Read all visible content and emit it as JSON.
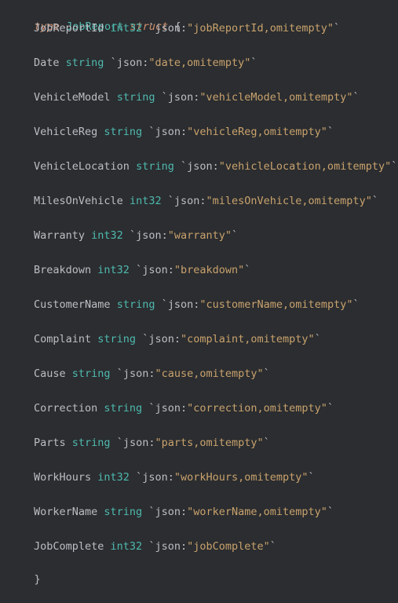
{
  "code": {
    "header": {
      "keyword": "type",
      "name": "JobReport",
      "struct_keyword": "struct",
      "open_brace": "{"
    },
    "fields": [
      {
        "name": "JobReportId",
        "type": "int32",
        "tag_prefix": "`json:",
        "tag_value": "\"jobReportId,omitempty\"",
        "tag_suffix": "`"
      },
      {
        "name": "Date",
        "type": "string",
        "tag_prefix": "`json:",
        "tag_value": "\"date,omitempty\"",
        "tag_suffix": "`"
      },
      {
        "name": "VehicleModel",
        "type": "string",
        "tag_prefix": "`json:",
        "tag_value": "\"vehicleModel,omitempty\"",
        "tag_suffix": "`"
      },
      {
        "name": "VehicleReg",
        "type": "string",
        "tag_prefix": "`json:",
        "tag_value": "\"vehicleReg,omitempty\"",
        "tag_suffix": "`"
      },
      {
        "name": "VehicleLocation",
        "type": "string",
        "tag_prefix": "`json:",
        "tag_value": "\"vehicleLocation,omitempty\"",
        "tag_suffix": "`"
      },
      {
        "name": "MilesOnVehicle",
        "type": "int32",
        "tag_prefix": "`json:",
        "tag_value": "\"milesOnVehicle,omitempty\"",
        "tag_suffix": "`"
      },
      {
        "name": "Warranty",
        "type": "int32",
        "tag_prefix": "`json:",
        "tag_value": "\"warranty\"",
        "tag_suffix": "`"
      },
      {
        "name": "Breakdown",
        "type": "int32",
        "tag_prefix": "`json:",
        "tag_value": "\"breakdown\"",
        "tag_suffix": "`"
      },
      {
        "name": "CustomerName",
        "type": "string",
        "tag_prefix": "`json:",
        "tag_value": "\"customerName,omitempty\"",
        "tag_suffix": "`"
      },
      {
        "name": "Complaint",
        "type": "string",
        "tag_prefix": "`json:",
        "tag_value": "\"complaint,omitempty\"",
        "tag_suffix": "`"
      },
      {
        "name": "Cause",
        "type": "string",
        "tag_prefix": "`json:",
        "tag_value": "\"cause,omitempty\"",
        "tag_suffix": "`"
      },
      {
        "name": "Correction",
        "type": "string",
        "tag_prefix": "`json:",
        "tag_value": "\"correction,omitempty\"",
        "tag_suffix": "`"
      },
      {
        "name": "Parts",
        "type": "string",
        "tag_prefix": "`json:",
        "tag_value": "\"parts,omitempty\"",
        "tag_suffix": "`"
      },
      {
        "name": "WorkHours",
        "type": "int32",
        "tag_prefix": "`json:",
        "tag_value": "\"workHours,omitempty\"",
        "tag_suffix": "`"
      },
      {
        "name": "WorkerName",
        "type": "string",
        "tag_prefix": "`json:",
        "tag_value": "\"workerName,omitempty\"",
        "tag_suffix": "`"
      },
      {
        "name": "JobComplete",
        "type": "int32",
        "tag_prefix": "`json:",
        "tag_value": "\"jobComplete\"",
        "tag_suffix": "`"
      }
    ],
    "close_brace": "}"
  },
  "colors": {
    "background": "#2b2d30",
    "keyword": "#cf8e6d",
    "type": "#4fb9af",
    "text": "#bcbec4",
    "string": "#c9a26d"
  }
}
